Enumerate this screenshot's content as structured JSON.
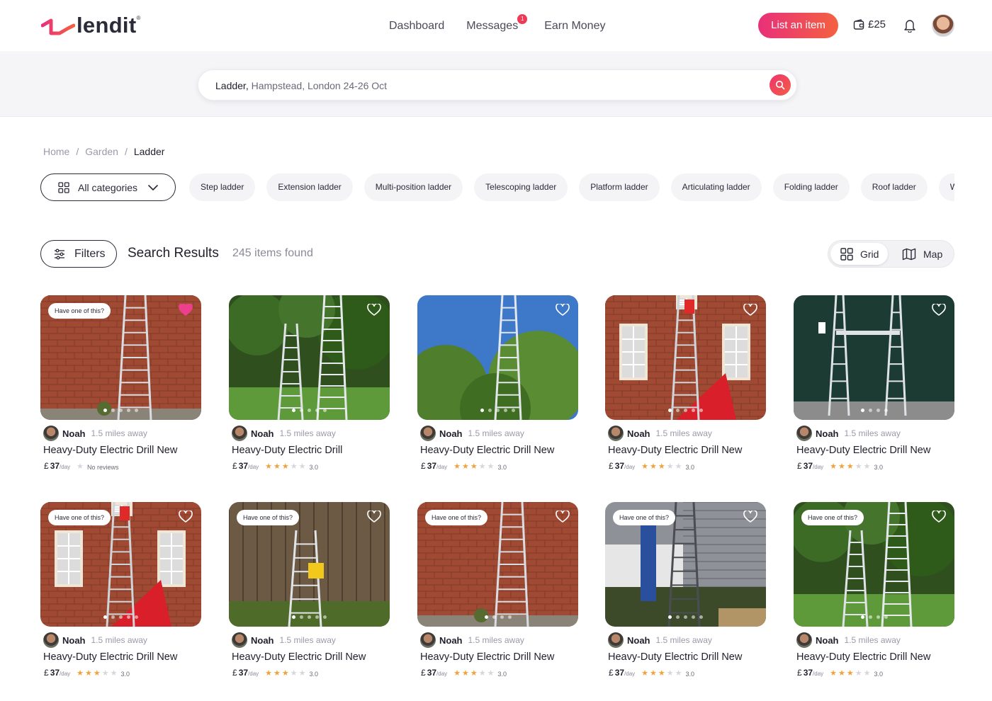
{
  "header": {
    "logo_text": "lendit",
    "logo_mark": "®",
    "nav": {
      "dashboard": "Dashboard",
      "messages": "Messages",
      "messages_badge": "1",
      "earn": "Earn Money"
    },
    "cta": "List an item",
    "wallet": "£25"
  },
  "search": {
    "item": "Ladder,",
    "rest": " Hampstead, London 24-26 Oct"
  },
  "breadcrumb": {
    "home": "Home",
    "sep1": "/",
    "garden": "Garden",
    "sep2": "/",
    "current": "Ladder"
  },
  "categories": {
    "all": "All categories",
    "chips": [
      "Step ladder",
      "Extension ladder",
      "Multi-position ladder",
      "Telescoping ladder",
      "Platform ladder",
      "Articulating ladder",
      "Folding ladder",
      "Roof ladder",
      "Wall ladder"
    ]
  },
  "results": {
    "filters": "Filters",
    "title": "Search Results",
    "count": "245 items found",
    "view_grid": "Grid",
    "view_map": "Map"
  },
  "cards": [
    {
      "scene": "brick",
      "have_one": "Have one of this?",
      "favorited": true,
      "owner": "Noah",
      "distance": "1.5 miles away",
      "title": "Heavy-Duty Electric Drill New",
      "currency": "£",
      "price": "37",
      "per": "/day",
      "rating": 0,
      "rating_text": "No reviews",
      "dots": 5,
      "active_dot": 0
    },
    {
      "scene": "garden",
      "have_one": "",
      "favorited": false,
      "owner": "Noah",
      "distance": "1.5 miles away",
      "title": "Heavy-Duty Electric Drill",
      "currency": "£",
      "price": "37",
      "per": "/day",
      "rating": 3,
      "rating_text": "3.0",
      "dots": 5,
      "active_dot": 0
    },
    {
      "scene": "sky",
      "have_one": "",
      "favorited": false,
      "owner": "Noah",
      "distance": "1.5 miles away",
      "title": "Heavy-Duty Electric Drill New",
      "currency": "£",
      "price": "37",
      "per": "/day",
      "rating": 3,
      "rating_text": "3.0",
      "dots": 5,
      "active_dot": 0
    },
    {
      "scene": "house",
      "have_one": "",
      "favorited": false,
      "owner": "Noah",
      "distance": "1.5 miles away",
      "title": "Heavy-Duty Electric Drill New",
      "currency": "£",
      "price": "37",
      "per": "/day",
      "rating": 3,
      "rating_text": "3.0",
      "dots": 5,
      "active_dot": 0
    },
    {
      "scene": "platform",
      "have_one": "",
      "favorited": false,
      "owner": "Noah",
      "distance": "1.5 miles away",
      "title": "Heavy-Duty Electric Drill New",
      "currency": "£",
      "price": "37",
      "per": "/day",
      "rating": 3,
      "rating_text": "3.0",
      "dots": 4,
      "active_dot": 0
    },
    {
      "scene": "house",
      "have_one": "Have one of this?",
      "favorited": false,
      "owner": "Noah",
      "distance": "1.5 miles away",
      "title": "Heavy-Duty Electric Drill New",
      "currency": "£",
      "price": "37",
      "per": "/day",
      "rating": 3,
      "rating_text": "3.0",
      "dots": 5,
      "active_dot": 0
    },
    {
      "scene": "fence",
      "have_one": "Have one of this?",
      "favorited": false,
      "owner": "Noah",
      "distance": "1.5 miles away",
      "title": "Heavy-Duty Electric Drill New",
      "currency": "£",
      "price": "37",
      "per": "/day",
      "rating": 3,
      "rating_text": "3.0",
      "dots": 5,
      "active_dot": 0
    },
    {
      "scene": "brick",
      "have_one": "Have one of this?",
      "favorited": false,
      "owner": "Noah",
      "distance": "1.5 miles away",
      "title": "Heavy-Duty Electric Drill New",
      "currency": "£",
      "price": "37",
      "per": "/day",
      "rating": 3,
      "rating_text": "3.0",
      "dots": 4,
      "active_dot": 0
    },
    {
      "scene": "porch",
      "have_one": "Have one of this?",
      "favorited": false,
      "owner": "Noah",
      "distance": "1.5 miles away",
      "title": "Heavy-Duty Electric Drill New",
      "currency": "£",
      "price": "37",
      "per": "/day",
      "rating": 3,
      "rating_text": "3.0",
      "dots": 5,
      "active_dot": 0
    },
    {
      "scene": "garden",
      "have_one": "Have one of this?",
      "favorited": false,
      "owner": "Noah",
      "distance": "1.5 miles away",
      "title": "Heavy-Duty Electric Drill New",
      "currency": "£",
      "price": "37",
      "per": "/day",
      "rating": 3,
      "rating_text": "3.0",
      "dots": 4,
      "active_dot": 0
    }
  ],
  "colors": {
    "brand_gradient_start": "#e8307a",
    "brand_gradient_end": "#f46140",
    "star": "#f2a23a",
    "heart_active": "#ec3f8c"
  },
  "icons": {
    "wallet": "wallet-icon",
    "bell": "bell-icon",
    "search": "search-icon",
    "grid": "grid-icon",
    "map": "map-icon",
    "filters": "sliders-icon",
    "chevron": "chevron-down-icon",
    "heart": "heart-icon",
    "star": "star-icon"
  }
}
